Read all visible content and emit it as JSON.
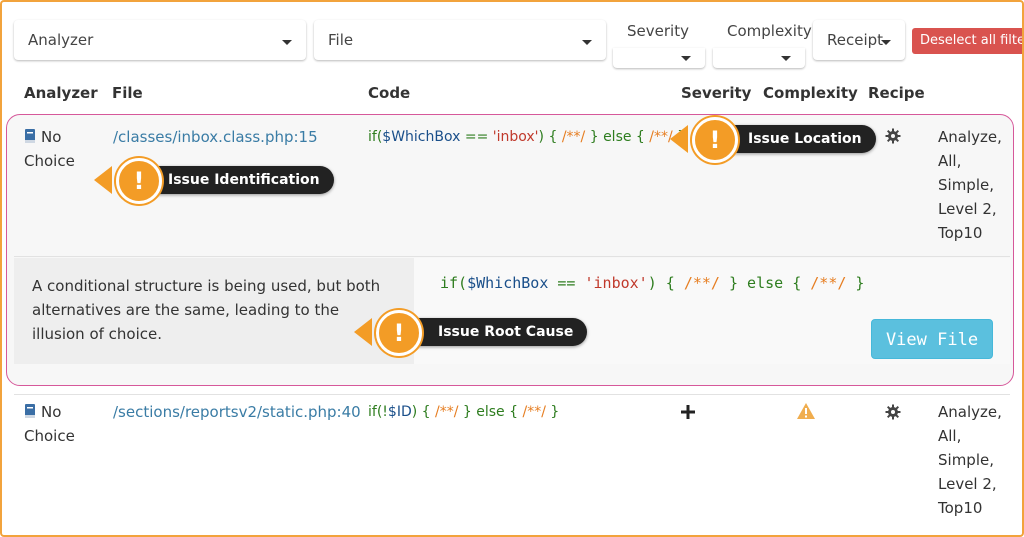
{
  "filters": {
    "analyzer": "Analyzer",
    "file": "File",
    "severity": "Severity",
    "complexity": "Complexity",
    "receipt": "Receipt",
    "deselect_all": "Deselect all filters"
  },
  "table": {
    "headers": [
      "Analyzer",
      "File",
      "Code",
      "Severity",
      "Complexity",
      "Recipe"
    ],
    "rows": [
      {
        "analyzer": "No Choice",
        "file": "/classes/inbox.class.php:15",
        "code_parts": [
          "if(",
          "$WhichBox",
          " == ",
          "'inbox'",
          ") { ",
          "/**/",
          " } else { ",
          "/**/",
          " }"
        ],
        "recipes": [
          "Analyze,",
          "All,",
          "Simple,",
          "Level 2,",
          "Top10"
        ]
      },
      {
        "analyzer": "No Choice",
        "file": "/sections/reportsv2/static.php:40",
        "code_parts": [
          "if(!",
          "$ID",
          ") { ",
          "/**/",
          " } else { ",
          "/**/",
          " }"
        ],
        "recipes": [
          "Analyze,",
          "All,",
          "Simple,",
          "Level 2,",
          "Top10"
        ]
      }
    ]
  },
  "detail": {
    "description": "A conditional structure is being used, but both alternatives are the same, leading to the illusion of choice.",
    "code_parts": [
      "if(",
      "$WhichBox",
      " == ",
      "'inbox'",
      ") { ",
      "/**/",
      " } else { ",
      "/**/",
      " }"
    ],
    "view_file": "View File"
  },
  "callouts": {
    "identification": "Issue Identification",
    "location": "Issue Location",
    "root_cause": "Issue Root Cause",
    "glyph": "!"
  },
  "icons": {
    "severity_row2": "plus-icon",
    "complexity_row2": "warning-icon",
    "recipe": "gear-icon",
    "analyzer": "book-icon"
  },
  "colors": {
    "frame": "#f2a33c",
    "highlight_border": "#d6589a",
    "deselect": "#d9534f",
    "view_button": "#5bc0de",
    "link": "#3a7ca5",
    "callout_badge": "#f39c26"
  }
}
